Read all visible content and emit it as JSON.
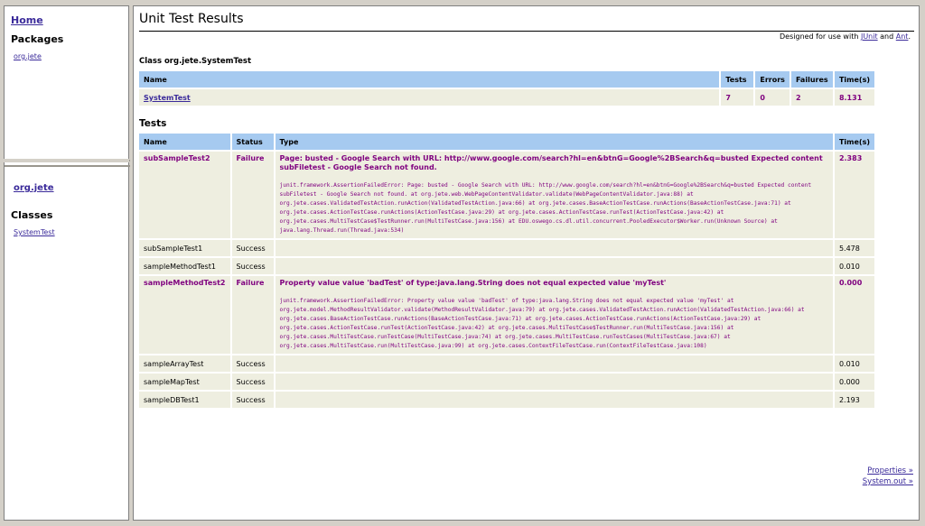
{
  "nav": {
    "home": "Home",
    "packages_heading": "Packages",
    "packages": [
      "org.jete"
    ],
    "package_title": "org.jete",
    "classes_heading": "Classes",
    "classes": [
      "SystemTest"
    ]
  },
  "header": {
    "title": "Unit Test Results",
    "designed_prefix": "Designed for use with",
    "junit": "JUnit",
    "and": "and",
    "ant": "Ant",
    "period": "."
  },
  "class_section": {
    "heading": "Class org.jete.SystemTest",
    "columns": [
      "Name",
      "Tests",
      "Errors",
      "Failures",
      "Time(s)"
    ],
    "row": {
      "name": "SystemTest",
      "tests": "7",
      "errors": "0",
      "failures": "2",
      "time": "8.131"
    }
  },
  "tests_section": {
    "heading": "Tests",
    "columns": [
      "Name",
      "Status",
      "Type",
      "Time(s)"
    ],
    "rows": [
      {
        "name": "subSampleTest2",
        "status": "Failure",
        "message": "Page: busted - Google Search with URL: http://www.google.com/search?hl=en&btnG=Google%2BSearch&q=busted Expected content subFiletest - Google Search not found.",
        "trace": "junit.framework.AssertionFailedError: Page: busted - Google Search with URL: http://www.google.com/search?hl=en&btnG=Google%2BSearch&q=busted Expected content subFiletest - Google Search not found. at org.jete.web.WebPageContentValidator.validate(WebPageContentValidator.java:88) at org.jete.cases.ValidatedTestAction.runAction(ValidatedTestAction.java:66) at org.jete.cases.BaseActionTestCase.runActions(BaseActionTestCase.java:71) at org.jete.cases.ActionTestCase.runActions(ActionTestCase.java:29) at org.jete.cases.ActionTestCase.runTest(ActionTestCase.java:42) at org.jete.cases.MultiTestCase$TestRunner.run(MultiTestCase.java:156) at EDU.oswego.cs.dl.util.concurrent.PooledExecutor$Worker.run(Unknown Source) at java.lang.Thread.run(Thread.java:534)",
        "time": "2.383"
      },
      {
        "name": "subSampleTest1",
        "status": "Success",
        "time": "5.478"
      },
      {
        "name": "sampleMethodTest1",
        "status": "Success",
        "time": "0.010"
      },
      {
        "name": "sampleMethodTest2",
        "status": "Failure",
        "message": "Property value value 'badTest' of type:java.lang.String does not equal expected value 'myTest'",
        "trace": "junit.framework.AssertionFailedError: Property value value 'badTest' of type:java.lang.String does not equal expected value 'myTest' at org.jete.model.MethodResultValidator.validate(MethodResultValidator.java:79) at org.jete.cases.ValidatedTestAction.runAction(ValidatedTestAction.java:66) at org.jete.cases.BaseActionTestCase.runActions(BaseActionTestCase.java:71) at org.jete.cases.ActionTestCase.runActions(ActionTestCase.java:29) at org.jete.cases.ActionTestCase.runTest(ActionTestCase.java:42) at org.jete.cases.MultiTestCase$TestRunner.run(MultiTestCase.java:156) at org.jete.cases.MultiTestCase.runTestCase(MultiTestCase.java:74) at org.jete.cases.MultiTestCase.runTestCases(MultiTestCase.java:67) at org.jete.cases.MultiTestCase.run(MultiTestCase.java:99) at org.jete.cases.ContextFileTestCase.run(ContextFileTestCase.java:108)",
        "time": "0.000"
      },
      {
        "name": "sampleArrayTest",
        "status": "Success",
        "time": "0.010"
      },
      {
        "name": "sampleMapTest",
        "status": "Success",
        "time": "0.000"
      },
      {
        "name": "sampleDBTest1",
        "status": "Success",
        "time": "2.193"
      }
    ]
  },
  "footer": {
    "properties": "Properties »",
    "system_out": "System.out »"
  },
  "colors": {
    "header_bg": "#a6caf0",
    "row_bg": "#eeeee0",
    "failure": "#7f007f",
    "link": "#3a2a9a"
  }
}
